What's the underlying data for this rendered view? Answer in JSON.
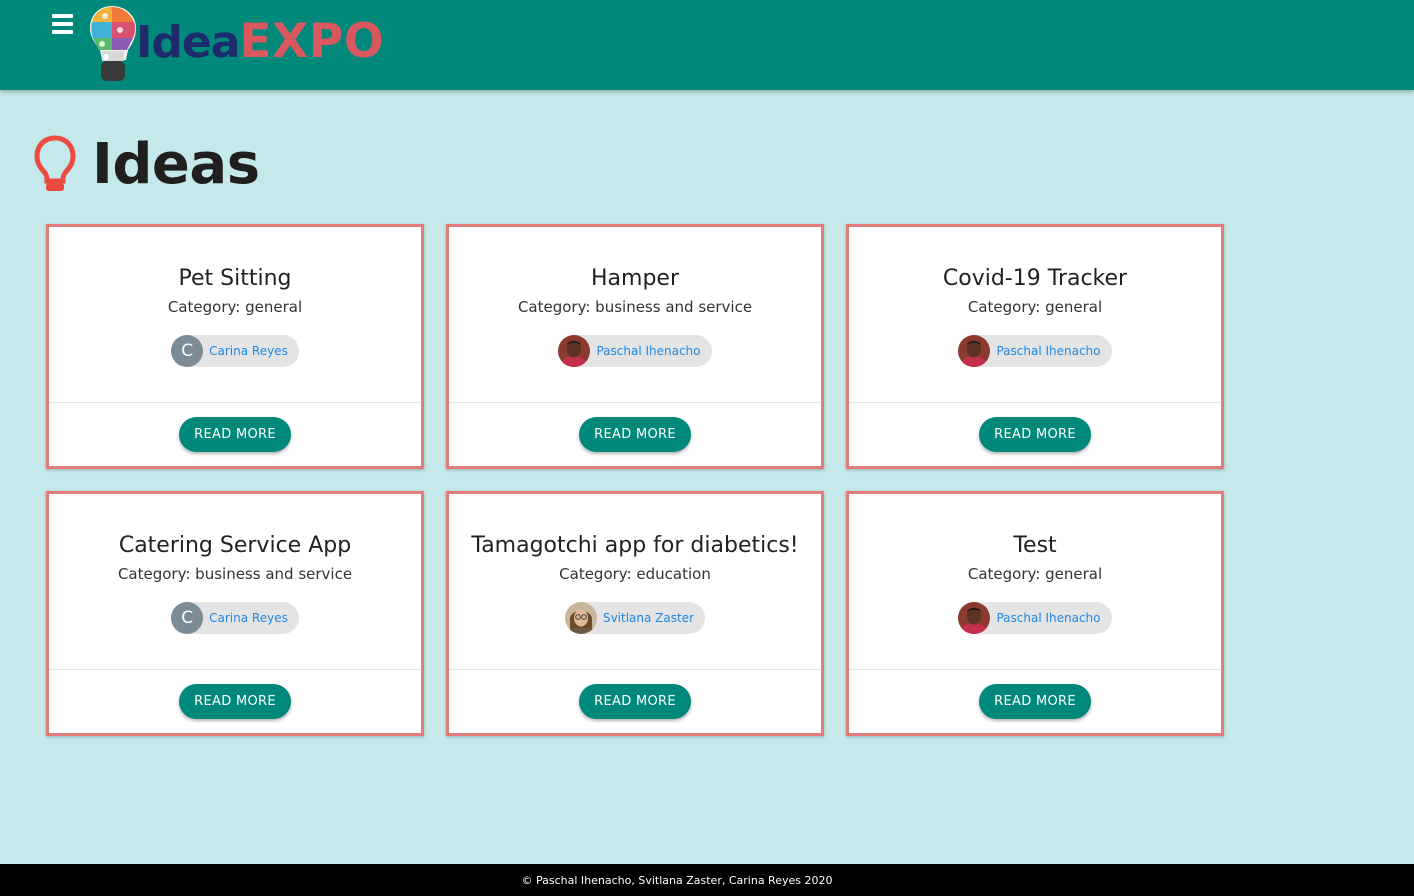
{
  "header": {
    "menu_icon": "hamburger-menu-icon",
    "logo": {
      "part1": "Idea",
      "part2": "EXPO"
    },
    "colors": {
      "bar": "#00897b",
      "logo_idea": "#1d2a6b",
      "logo_expo": "#d9585f"
    }
  },
  "page": {
    "title": "Ideas",
    "title_icon": "lightbulb-icon",
    "background": "#c5e8ea"
  },
  "ideas": [
    {
      "title": "Pet Sitting",
      "category": "Category: general",
      "author": "Carina Reyes",
      "avatar": "C",
      "avatar_type": "initial",
      "button": "READ MORE"
    },
    {
      "title": "Hamper",
      "category": "Category: business and service",
      "author": "Paschal Ihenacho",
      "avatar": "person-avatar",
      "avatar_type": "photo",
      "button": "READ MORE"
    },
    {
      "title": "Covid-19 Tracker",
      "category": "Category: general",
      "author": "Paschal Ihenacho",
      "avatar": "person-avatar",
      "avatar_type": "photo",
      "button": "READ MORE"
    },
    {
      "title": "Catering Service App",
      "category": "Category: business and service",
      "author": "Carina Reyes",
      "avatar": "C",
      "avatar_type": "initial",
      "button": "READ MORE"
    },
    {
      "title": "Tamagotchi app for diabetics!",
      "category": "Category: education",
      "author": "Svitlana Zaster",
      "avatar": "person-avatar",
      "avatar_type": "photo",
      "button": "READ MORE"
    },
    {
      "title": "Test",
      "category": "Category: general",
      "author": "Paschal Ihenacho",
      "avatar": "person-avatar",
      "avatar_type": "photo",
      "button": "READ MORE"
    }
  ],
  "footer": {
    "text": "© Paschal Ihenacho, Svitlana Zaster, Carina Reyes 2020"
  }
}
